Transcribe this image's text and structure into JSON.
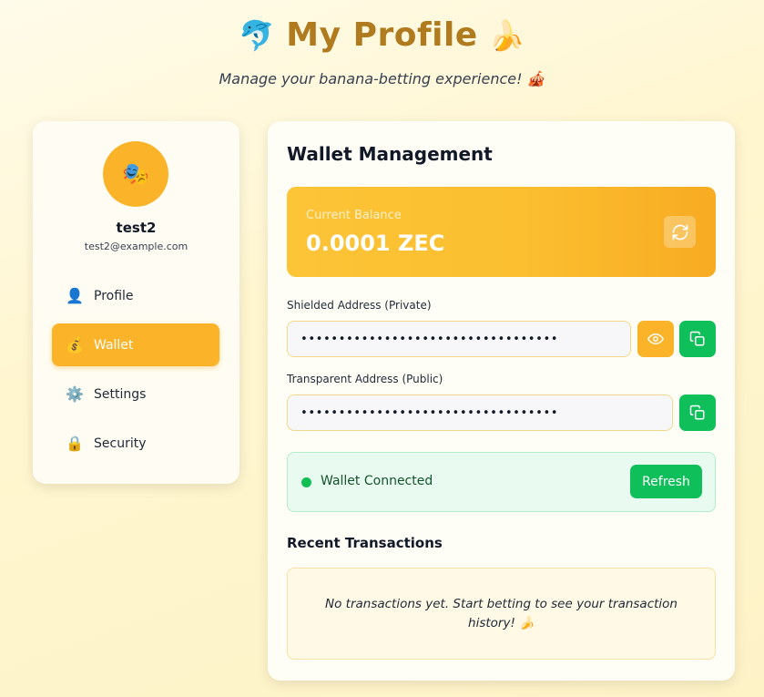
{
  "header": {
    "title": "My Profile",
    "title_left_emoji": "🐬",
    "title_right_emoji": "🍌",
    "subtitle": "Manage your banana-betting experience! 🎪"
  },
  "user": {
    "avatar_emoji": "🎭",
    "username": "test2",
    "email": "test2@example.com"
  },
  "sidebar": {
    "items": [
      {
        "icon": "👤",
        "label": "Profile",
        "active": false
      },
      {
        "icon": "💰",
        "label": "Wallet",
        "active": true
      },
      {
        "icon": "⚙️",
        "label": "Settings",
        "active": false
      },
      {
        "icon": "🔒",
        "label": "Security",
        "active": false
      }
    ]
  },
  "wallet": {
    "title": "Wallet Management",
    "balance_label": "Current Balance",
    "balance_value": "0.0001 ZEC",
    "shielded_label": "Shielded Address (Private)",
    "shielded_value": "••••••••••••••••••••••••••••••••••",
    "transparent_label": "Transparent Address (Public)",
    "transparent_value": "••••••••••••••••••••••••••••••••••",
    "status_text": "Wallet Connected",
    "refresh_label": "Refresh",
    "transactions_title": "Recent Transactions",
    "transactions_empty": "No transactions yet. Start betting to see your transaction history! 🍌"
  },
  "colors": {
    "accent": "#fbb42a",
    "title": "#b07a1f",
    "success": "#0fbf5a"
  }
}
